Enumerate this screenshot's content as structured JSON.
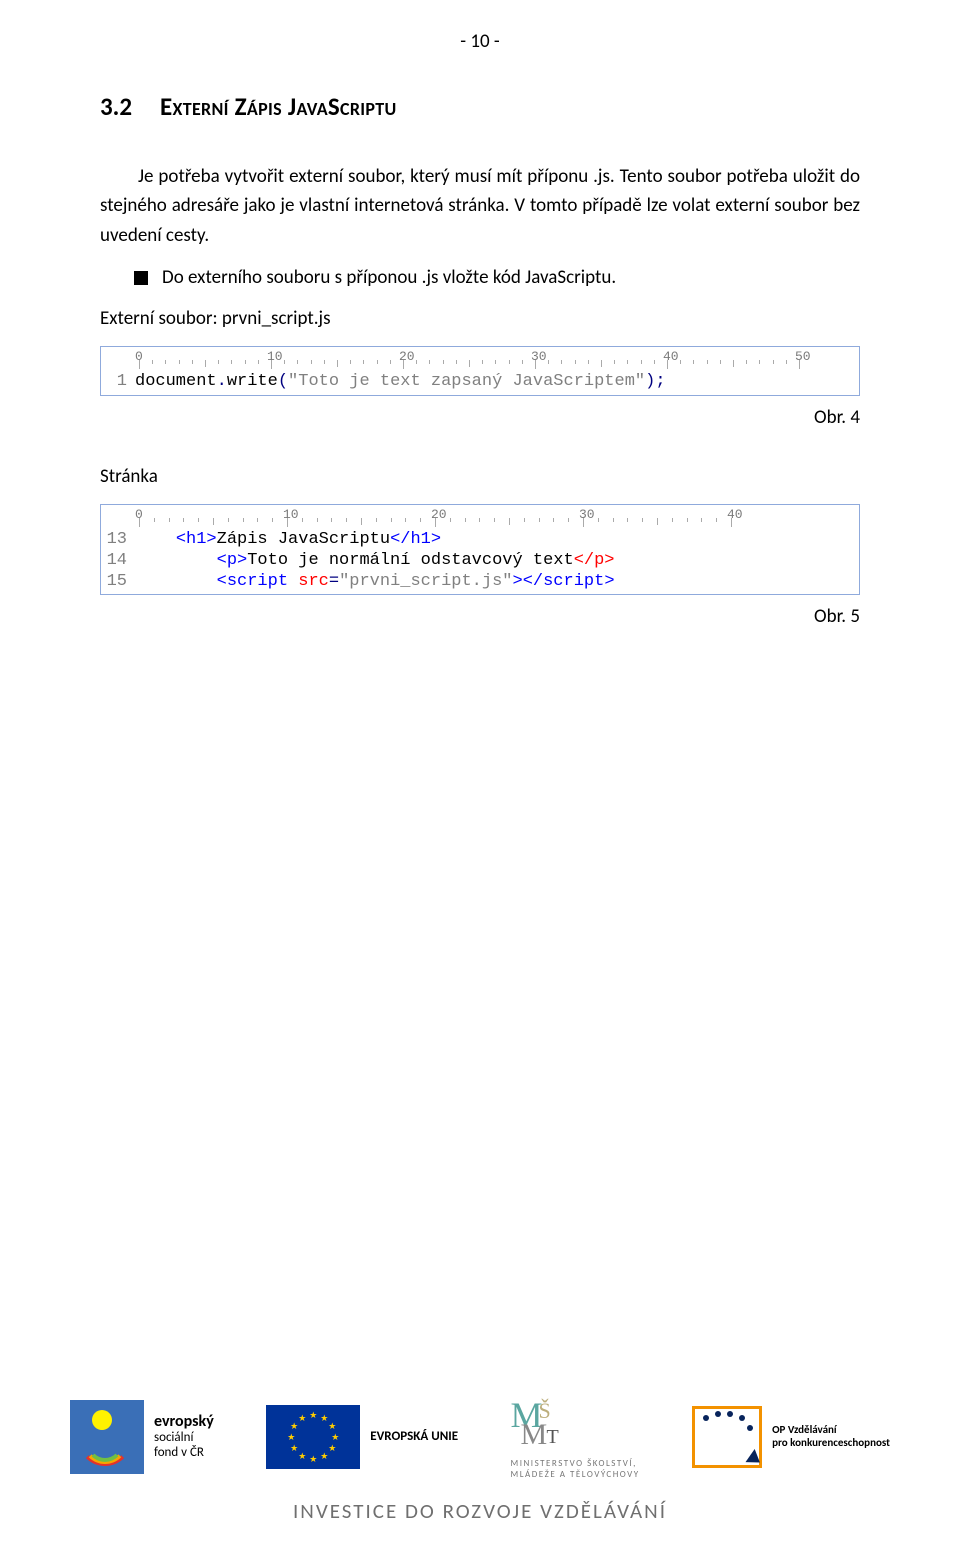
{
  "page_number": "- 10 -",
  "heading": {
    "num": "3.2",
    "title": "Externí Zápis JavaScriptu"
  },
  "para1": "Je potřeba vytvořit externí soubor, který musí mít příponu .js. Tento soubor potřeba uložit do stejného adresáře jako je vlastní internetová stránka. V tomto případě lze volat externí soubor bez uvedení cesty.",
  "bullet1": "Do externího souboru s příponou .js vložte kód JavaScriptu.",
  "ext_label": "Externí soubor: prvni_script.js",
  "code1": {
    "ruler_max": 50,
    "lines": [
      {
        "n": "1",
        "tokens": [
          {
            "t": "document",
            "c": "c-plain"
          },
          {
            "t": ".",
            "c": "c-punc"
          },
          {
            "t": "write",
            "c": "c-plain"
          },
          {
            "t": "(",
            "c": "c-punc"
          },
          {
            "t": "\"Toto je text zapsaný JavaScriptem\"",
            "c": "c-str"
          },
          {
            "t": ")",
            "c": "c-punc"
          },
          {
            "t": ";",
            "c": "c-punc"
          }
        ]
      }
    ]
  },
  "fig1": "Obr. 4",
  "page_label": "Stránka",
  "code2": {
    "ruler_max": 40,
    "lines": [
      {
        "n": "13",
        "indent": "    ",
        "tokens": [
          {
            "t": "<h1>",
            "c": "c-tag"
          },
          {
            "t": "Zápis JavaScriptu",
            "c": "c-plain"
          },
          {
            "t": "</h1>",
            "c": "c-tag"
          }
        ]
      },
      {
        "n": "14",
        "indent": "        ",
        "tokens": [
          {
            "t": "<p>",
            "c": "c-tag"
          },
          {
            "t": "Toto je normální odstavcový text",
            "c": "c-plain"
          },
          {
            "t": "</p>",
            "c": "c-tagcl"
          }
        ]
      },
      {
        "n": "15",
        "indent": "        ",
        "tokens": [
          {
            "t": "<script ",
            "c": "c-tag"
          },
          {
            "t": "src",
            "c": "c-attr"
          },
          {
            "t": "=",
            "c": "c-punc"
          },
          {
            "t": "\"prvni_script.js\"",
            "c": "c-str"
          },
          {
            "t": ">",
            "c": "c-tag"
          },
          {
            "t": "</script>",
            "c": "c-tag"
          }
        ]
      }
    ]
  },
  "fig2": "Obr. 5",
  "footer": {
    "esf": {
      "l1": "evropský",
      "l2": "sociální",
      "l3": "fond v ČR",
      "eu": "EVROPSKÁ UNIE"
    },
    "msmt": {
      "l1": "MINISTERSTVO ŠKOLSTVÍ,",
      "l2": "MLÁDEŽE A TĚLOVÝCHOVY"
    },
    "opvk": {
      "l1": "OP Vzdělávání",
      "l2": "pro konkurenceschopnost"
    },
    "invest": "INVESTICE DO ROZVOJE VZDĚLÁVÁNÍ"
  }
}
